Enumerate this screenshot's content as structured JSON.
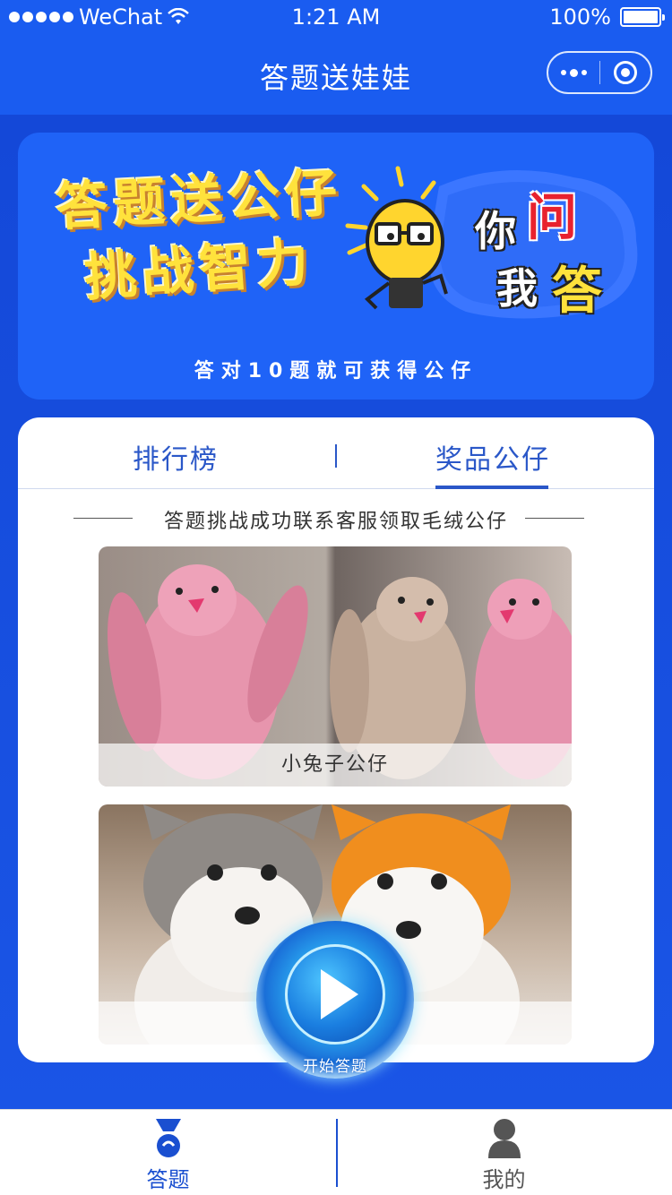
{
  "status_bar": {
    "carrier": "WeChat",
    "time": "1:21 AM",
    "battery": "100%"
  },
  "nav": {
    "title": "答题送娃娃"
  },
  "banner": {
    "title_line1": "答题送公仔",
    "title_line2": "挑战智力",
    "qa_word1": "你",
    "qa_word2": "问",
    "qa_word3": "我",
    "qa_word4": "答",
    "subtitle": "答对10题就可获得公仔"
  },
  "tabs": [
    {
      "label": "排行榜"
    },
    {
      "label": "奖品公仔"
    }
  ],
  "section": {
    "title": "答题挑战成功联系客服领取毛绒公仔"
  },
  "prizes": [
    {
      "caption": "小兔子公仔"
    },
    {
      "caption": ""
    }
  ],
  "start_button": {
    "label": "开始答题"
  },
  "tabbar": [
    {
      "label": "答题"
    },
    {
      "label": "我的"
    }
  ],
  "colors": {
    "primary": "#1a5cf0",
    "tab_text": "#2a57c8",
    "banner_yellow": "#ffe23c"
  }
}
